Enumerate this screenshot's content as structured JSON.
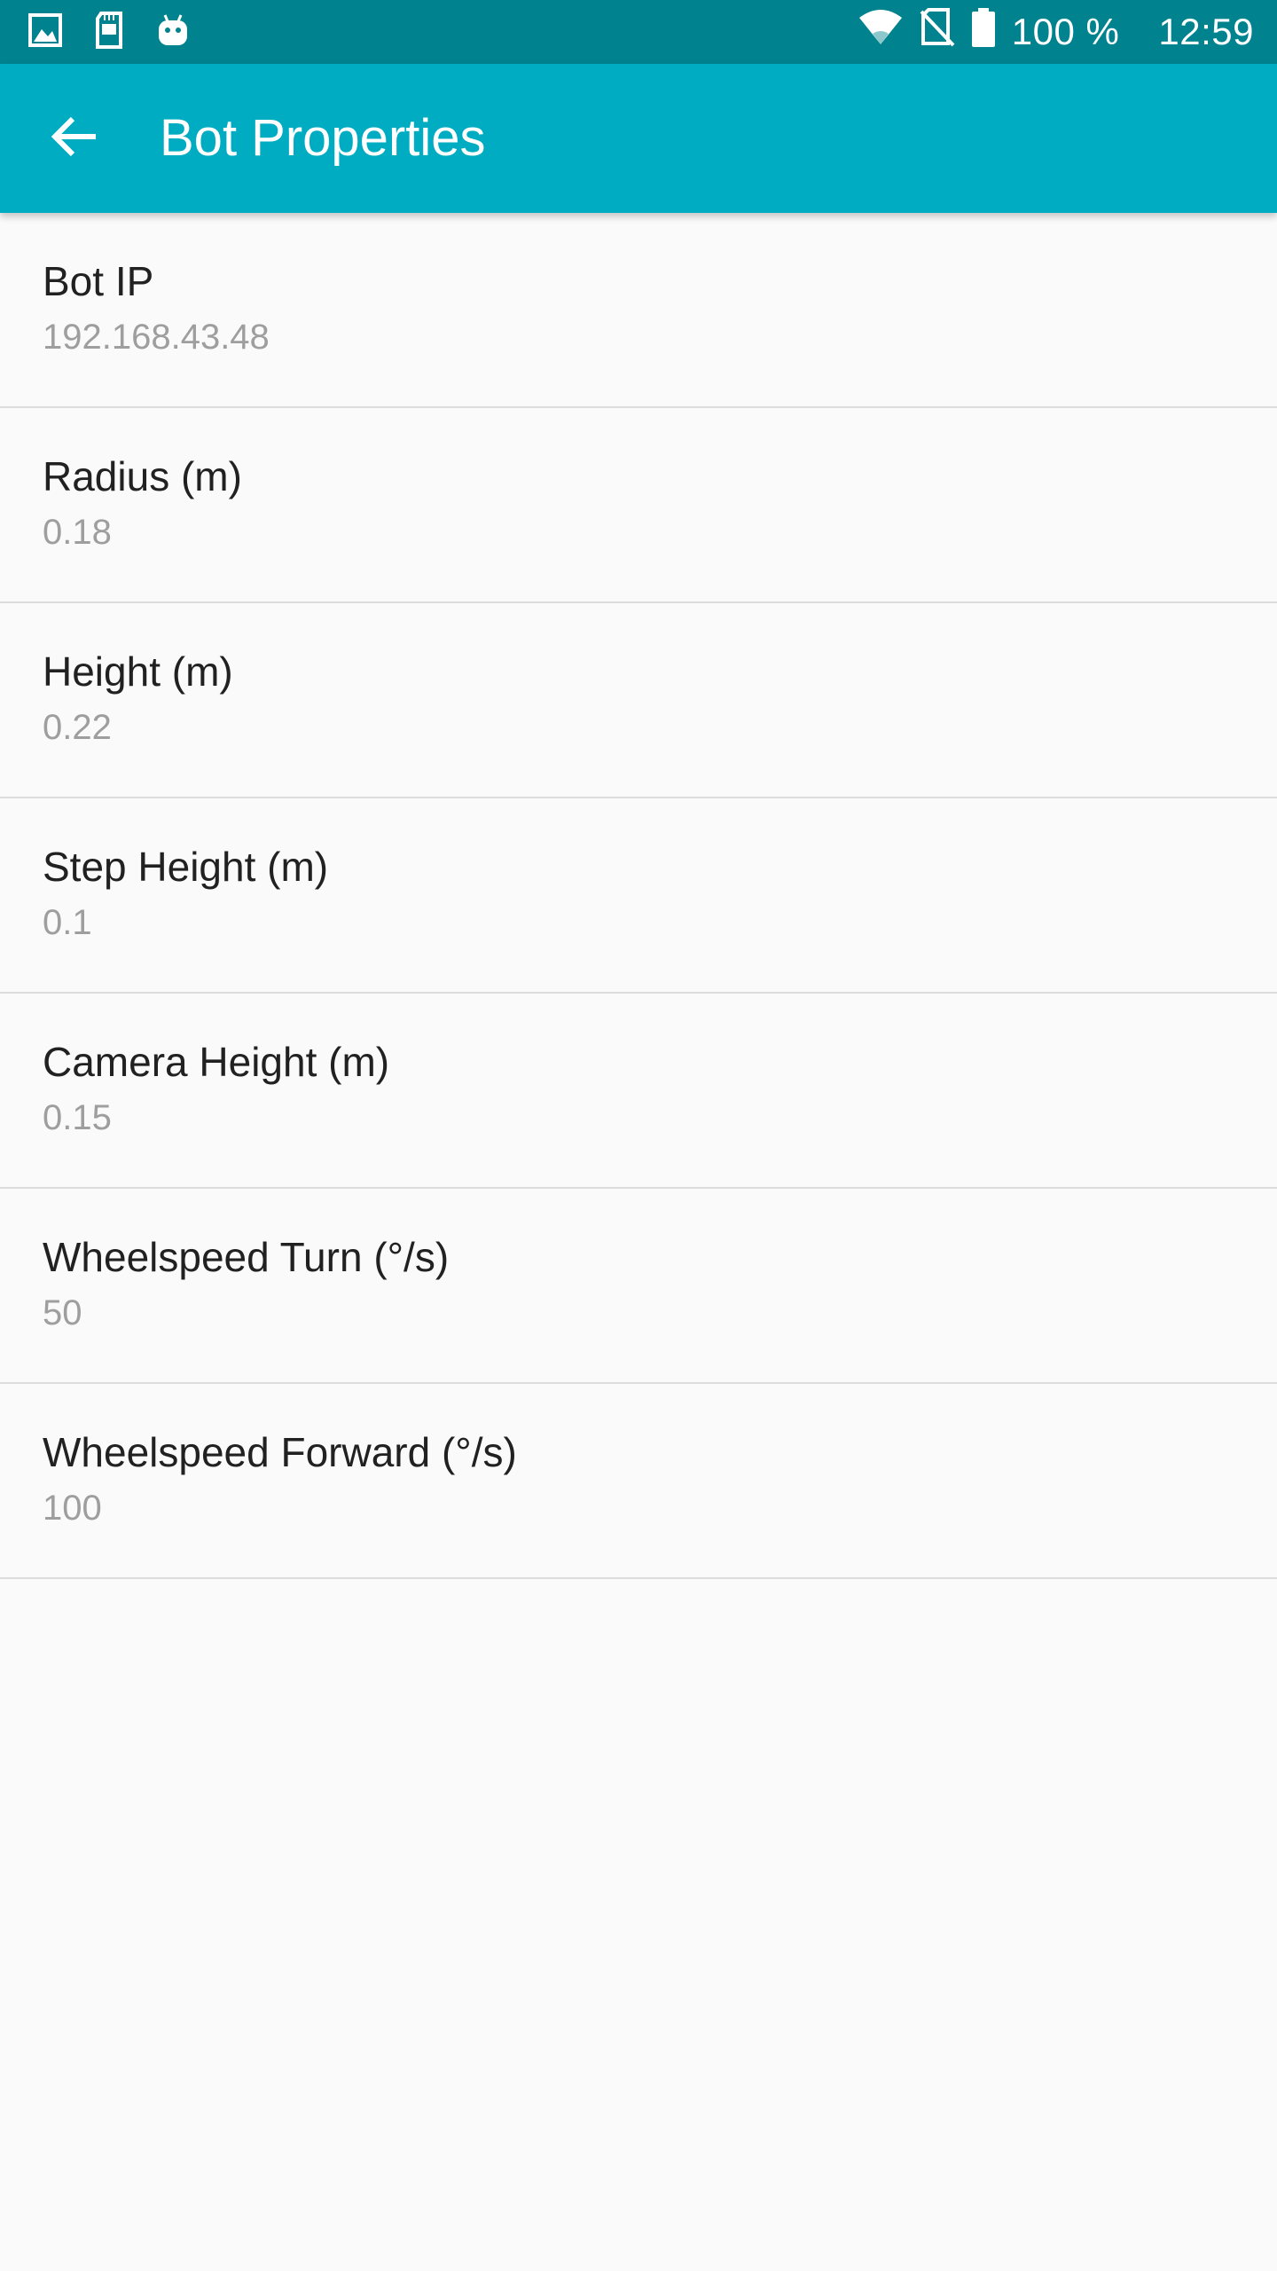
{
  "status_bar": {
    "left_icons": [
      "image-icon",
      "sd-card-icon",
      "android-icon"
    ],
    "battery_text": "100 %",
    "time": "12:59",
    "right_icons": [
      "wifi-icon",
      "no-sim-icon",
      "battery-icon"
    ]
  },
  "app_bar": {
    "title": "Bot Properties",
    "back_icon": "arrow-back-icon"
  },
  "preferences": [
    {
      "title": "Bot IP",
      "summary": "192.168.43.48"
    },
    {
      "title": "Radius (m)",
      "summary": "0.18"
    },
    {
      "title": "Height (m)",
      "summary": "0.22"
    },
    {
      "title": "Step Height (m)",
      "summary": "0.1"
    },
    {
      "title": "Camera Height (m)",
      "summary": "0.15"
    },
    {
      "title": "Wheelspeed Turn (°/s)",
      "summary": "50"
    },
    {
      "title": "Wheelspeed Forward (°/s)",
      "summary": "100"
    }
  ],
  "colors": {
    "status_bar": "#00838f",
    "app_bar": "#00acc1",
    "background": "#fafafa",
    "title_text": "#212121",
    "summary_text": "#9e9e9e",
    "divider": "#dcdcdc"
  }
}
